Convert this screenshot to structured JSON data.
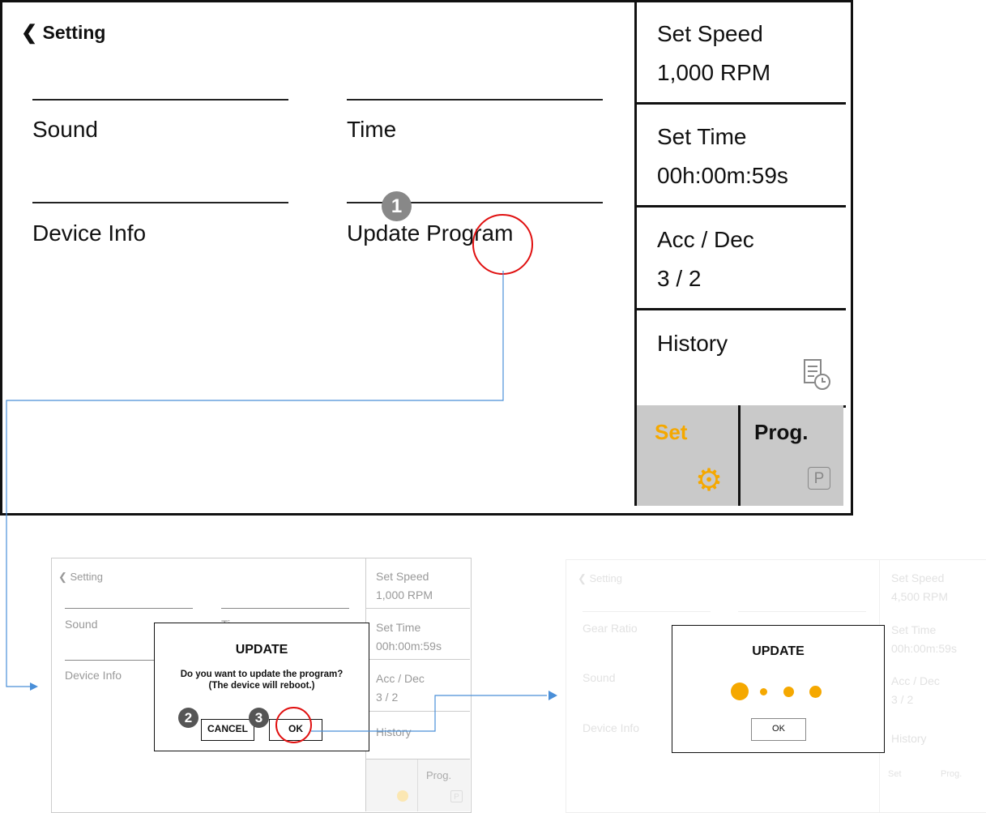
{
  "screen": {
    "back_label": "Setting",
    "menu": {
      "sound": "Sound",
      "time": "Time",
      "device_info": "Device Info",
      "update_program": "Update Program"
    },
    "side": {
      "speed_label": "Set Speed",
      "speed_value": "1,000 RPM",
      "time_label": "Set Time",
      "time_value": "00h:00m:59s",
      "accdec_label": "Acc / Dec",
      "accdec_value": "3 / 2",
      "history_label": "History",
      "tab_set": "Set",
      "tab_prog": "Prog.",
      "prog_icon_letter": "P"
    },
    "accent_color": "#f5a800"
  },
  "steps": {
    "one": "1",
    "two": "2",
    "three": "3"
  },
  "confirm_panel": {
    "back_label": "Setting",
    "menu": {
      "sound": "Sound",
      "time_partial": "Ti",
      "device_info": "Device Info"
    },
    "side": {
      "speed_label": "Set Speed",
      "speed_value": "1,000 RPM",
      "time_label": "Set Time",
      "time_value": "00h:00m:59s",
      "accdec_label": "Acc / Dec",
      "accdec_value": "3 / 2",
      "history_label": "History",
      "tab_prog": "Prog.",
      "prog_icon_letter": "P"
    },
    "dialog": {
      "title": "UPDATE",
      "line1": "Do you want to update the program?",
      "line2": "(The device will reboot.)",
      "cancel": "CANCEL",
      "ok": "OK"
    }
  },
  "progress_panel": {
    "back_label": "Setting",
    "menu": {
      "gear_ratio": "Gear Ratio",
      "sound": "Sound",
      "device_info": "Device Info"
    },
    "side": {
      "speed_label": "Set Speed",
      "speed_value": "4,500 RPM",
      "time_label": "Set Time",
      "time_value": "00h:00m:59s",
      "accdec_label": "Acc / Dec",
      "accdec_value": "3 / 2",
      "history_label": "History",
      "tab_set": "Set",
      "tab_prog": "Prog."
    },
    "dialog": {
      "title": "UPDATE",
      "ok": "OK"
    }
  },
  "colors": {
    "highlight_circle": "#e01010",
    "connector": "#4a8fd8",
    "dot": "#f5a800"
  }
}
